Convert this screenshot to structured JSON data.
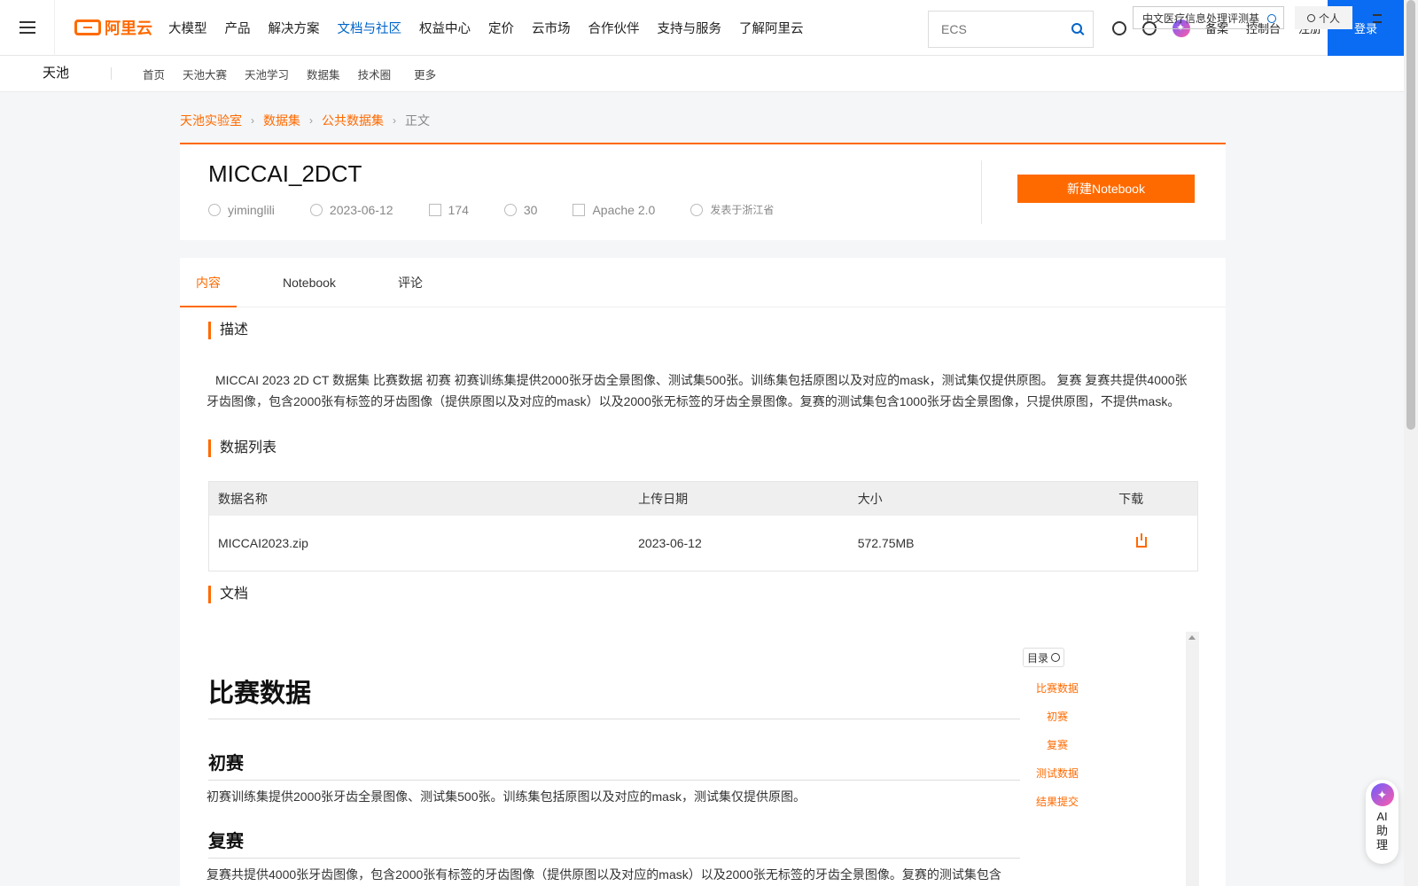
{
  "topnav": {
    "logo_text": "阿里云",
    "items": [
      "大模型",
      "产品",
      "解决方案",
      "文档与社区",
      "权益中心",
      "定价",
      "云市场",
      "合作伙伴",
      "支持与服务",
      "了解阿里云"
    ],
    "active_index": 3,
    "search_placeholder": "ECS",
    "links": [
      "备案",
      "控制台",
      "注册"
    ],
    "login": "登录"
  },
  "subnav": {
    "brand": "天池",
    "items": [
      "首页",
      "天池大赛",
      "天池学习",
      "数据集",
      "技术圈",
      "更多"
    ],
    "search_value": "中文医疗信息处理评测基",
    "personal": "个人"
  },
  "breadcrumb": {
    "items": [
      "天池实验室",
      "数据集",
      "公共数据集"
    ],
    "current": "正文"
  },
  "dataset": {
    "title": "MICCAI_2DCT",
    "author": "yiminglili",
    "date": "2023-06-12",
    "downloads": "174",
    "shares": "30",
    "license": "Apache 2.0",
    "location": "发表于浙江省",
    "new_notebook": "新建Notebook"
  },
  "tabs": [
    "内容",
    "Notebook",
    "评论"
  ],
  "description": {
    "heading": "描述",
    "text": "MICCAI 2023 2D CT 数据集 比赛数据 初赛 初赛训练集提供2000张牙齿全景图像、测试集500张。训练集包括原图以及对应的mask，测试集仅提供原图。 复赛 复赛共提供4000张牙齿图像，包含2000张有标签的牙齿图像（提供原图以及对应的mask）以及2000张无标签的牙齿全景图像。复赛的测试集包含1000张牙齿全景图像，只提供原图，不提供mask。"
  },
  "data_list": {
    "heading": "数据列表",
    "columns": [
      "数据名称",
      "上传日期",
      "大小",
      "下载"
    ],
    "rows": [
      {
        "name": "MICCAI2023.zip",
        "date": "2023-06-12",
        "size": "572.75MB"
      }
    ]
  },
  "document": {
    "heading": "文档",
    "h1": "比赛数据",
    "h2_prelim": "初赛",
    "p_prelim": "初赛训练集提供2000张牙齿全景图像、测试集500张。训练集包括原图以及对应的mask，测试集仅提供原图。",
    "h2_final": "复赛",
    "p_final": "复赛共提供4000张牙齿图像，包含2000张有标签的牙齿图像（提供原图以及对应的mask）以及2000张无标签的牙齿全景图像。复赛的测试集包含",
    "toc_label": "目录",
    "toc": [
      "比赛数据",
      "初赛",
      "复赛",
      "测试数据",
      "结果提交"
    ]
  },
  "ai_helper": "AI助理"
}
